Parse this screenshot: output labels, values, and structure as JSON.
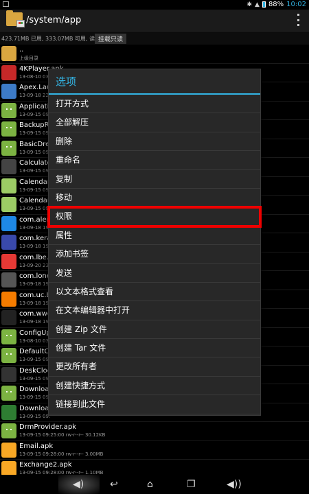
{
  "status": {
    "battery": "88%",
    "time": "10:02"
  },
  "header": {
    "path": "/system/app"
  },
  "storage": {
    "info": "423.71MB 已用, 333.07MB 可用, 读写",
    "button": "挂载只读"
  },
  "files": [
    {
      "name": "..",
      "meta": "上级目录",
      "icon": "folder",
      "color": "#d9a640"
    },
    {
      "name": "4KPlayer.apk",
      "meta": "13-08-10 03:",
      "icon": "app",
      "color": "#c62828"
    },
    {
      "name": "Apex.Laun",
      "meta": "13-09-18 22:",
      "icon": "app",
      "color": "#3d7bc7"
    },
    {
      "name": "Application",
      "meta": "13-09-15 09:",
      "icon": "android",
      "color": "#7cb342"
    },
    {
      "name": "BackupRe",
      "meta": "13-09-15 09:",
      "icon": "android",
      "color": "#7cb342"
    },
    {
      "name": "BasicDrea",
      "meta": "13-09-15 09:",
      "icon": "android",
      "color": "#7cb342"
    },
    {
      "name": "Calculator",
      "meta": "13-09-15 09:",
      "icon": "app",
      "color": "#444"
    },
    {
      "name": "Calendar.a",
      "meta": "13-09-15 09:",
      "icon": "app",
      "color": "#9ccc65"
    },
    {
      "name": "CalendarP",
      "meta": "13-09-15 09:",
      "icon": "app",
      "color": "#9ccc65"
    },
    {
      "name": "com.alen",
      "meta": "13-09-18 19:",
      "icon": "app",
      "color": "#1e88e5"
    },
    {
      "name": "com.kerac",
      "meta": "13-09-18 19:",
      "icon": "app",
      "color": "#3949ab"
    },
    {
      "name": "com.lbe.s",
      "meta": "13-09-20 23:",
      "icon": "app",
      "color": "#e53935"
    },
    {
      "name": "com.lonel",
      "meta": "13-09-18 19:",
      "icon": "app",
      "color": "#555"
    },
    {
      "name": "com.uc.br",
      "meta": "13-09-18 19:",
      "icon": "app",
      "color": "#f57c00"
    },
    {
      "name": "com.wwdr",
      "meta": "13-09-18 19:",
      "icon": "app",
      "color": "#222"
    },
    {
      "name": "ConfigUpd",
      "meta": "13-08-10 03:",
      "icon": "android",
      "color": "#7cb342"
    },
    {
      "name": "DefaultCo",
      "meta": "13-09-15 09:",
      "icon": "android",
      "color": "#7cb342"
    },
    {
      "name": "DeskClock",
      "meta": "13-09-15 09:",
      "icon": "app",
      "color": "#333"
    },
    {
      "name": "Download",
      "meta": "13-09-15 09:",
      "icon": "android",
      "color": "#7cb342"
    },
    {
      "name": "Download",
      "meta": "13-09-15 09:",
      "icon": "app",
      "color": "#2e7d32"
    },
    {
      "name": "DrmProvider.apk",
      "meta": "13-09-15 09:25:00  rw-r--r--  30.12KB",
      "icon": "android",
      "color": "#7cb342"
    },
    {
      "name": "Email.apk",
      "meta": "13-09-15 09:28:00  rw-r--r--  3.00MB",
      "icon": "app",
      "color": "#f9a825"
    },
    {
      "name": "Exchange2.apk",
      "meta": "13-09-15 09:28:00  rw-r--r--  1.10MB",
      "icon": "app",
      "color": "#f9a825"
    }
  ],
  "dialog": {
    "title": "选项",
    "items": [
      "打开方式",
      "全部解压",
      "删除",
      "重命名",
      "复制",
      "移动",
      "权限",
      "属性",
      "添加书签",
      "发送",
      "以文本格式查看",
      "在文本编辑器中打开",
      "创建 Zip 文件",
      "创建 Tar 文件",
      "更改所有者",
      "创建快捷方式",
      "链接到此文件"
    ],
    "highlighted_index": 6,
    "highlight_color": "#e00000",
    "accent_color": "#33b5e5"
  },
  "navbar": {
    "icons": [
      "volume-down-icon",
      "back-icon",
      "home-icon",
      "recents-icon",
      "volume-up-icon"
    ]
  }
}
